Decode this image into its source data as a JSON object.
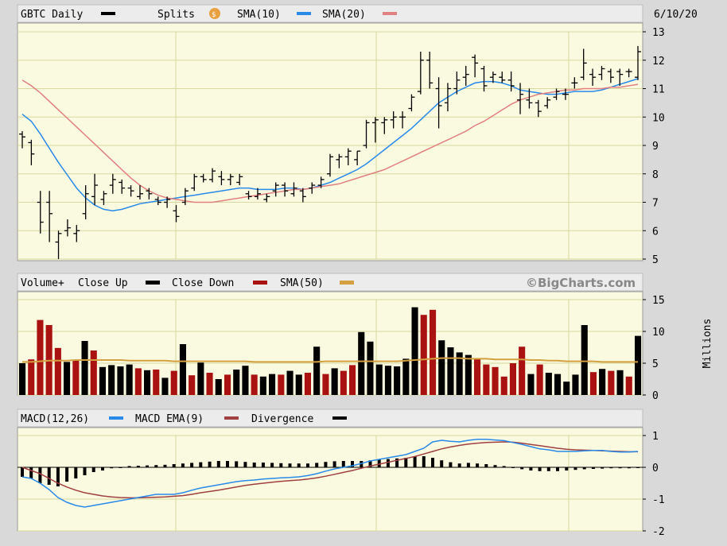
{
  "header": {
    "symbol_label": "GBTC Daily",
    "splits_label": "Splits",
    "splits_icon": "dollar-coin-icon",
    "sma10_label": "SMA(10)",
    "sma20_label": "SMA(20)",
    "date": "6/10/20"
  },
  "volume_header": {
    "title": "Volume+",
    "close_up_label": "Close Up",
    "close_down_label": "Close Down",
    "sma50_label": "SMA(50)",
    "brand": "©BigCharts.com",
    "unit_label": "Millions"
  },
  "macd_header": {
    "macd_label": "MACD(12,26)",
    "ema_label": "MACD EMA(9)",
    "divergence_label": "Divergence"
  },
  "colors": {
    "plot_bg": "#fafae0",
    "grid": "#d8d8a0",
    "frame": "#d9d9d9",
    "header_bg": "#ececec",
    "sma10": "#2a8ae8",
    "sma20": "#e08080",
    "up": "#000000",
    "down": "#aa1111",
    "sma50": "#d4a040",
    "macd": "#2a8ae8",
    "ema": "#a04040",
    "divergence": "#000000"
  },
  "chart_data": [
    {
      "type": "ohlc",
      "title": "GBTC Daily",
      "ylim": [
        5,
        13
      ],
      "yticks": [
        "5",
        "6",
        "7",
        "8",
        "9",
        "10",
        "11",
        "12",
        "13"
      ],
      "grid": true,
      "bars": [
        [
          9.4,
          9.5,
          8.9,
          9.3
        ],
        [
          9.1,
          9.2,
          8.3,
          8.7
        ],
        [
          7.0,
          7.4,
          5.9,
          6.3
        ],
        [
          7.0,
          7.4,
          5.6,
          6.6
        ],
        [
          5.6,
          6.0,
          5.0,
          5.9
        ],
        [
          6.0,
          6.4,
          5.8,
          6.1
        ],
        [
          5.9,
          6.2,
          5.6,
          6.0
        ],
        [
          6.6,
          7.6,
          6.4,
          7.3
        ],
        [
          7.2,
          8.0,
          6.9,
          7.6
        ],
        [
          7.1,
          7.4,
          6.9,
          7.3
        ],
        [
          7.6,
          8.0,
          7.3,
          7.8
        ],
        [
          7.7,
          7.8,
          7.3,
          7.5
        ],
        [
          7.5,
          7.6,
          7.2,
          7.4
        ],
        [
          7.2,
          7.6,
          7.1,
          7.3
        ],
        [
          7.4,
          7.5,
          7.1,
          7.3
        ],
        [
          7.1,
          7.2,
          6.9,
          7.0
        ],
        [
          7.0,
          7.2,
          6.8,
          7.1
        ],
        [
          6.7,
          6.9,
          6.3,
          6.5
        ],
        [
          7.0,
          7.5,
          6.9,
          7.4
        ],
        [
          7.5,
          8.0,
          7.4,
          7.9
        ],
        [
          7.9,
          8.0,
          7.7,
          7.8
        ],
        [
          7.8,
          8.2,
          7.7,
          8.1
        ],
        [
          7.9,
          8.1,
          7.6,
          7.8
        ],
        [
          7.8,
          8.0,
          7.6,
          7.9
        ],
        [
          7.7,
          8.0,
          7.6,
          7.9
        ],
        [
          7.3,
          7.4,
          7.1,
          7.2
        ],
        [
          7.2,
          7.5,
          7.1,
          7.3
        ],
        [
          7.1,
          7.3,
          7.0,
          7.2
        ],
        [
          7.4,
          7.7,
          7.2,
          7.6
        ],
        [
          7.6,
          7.7,
          7.2,
          7.4
        ],
        [
          7.3,
          7.7,
          7.2,
          7.5
        ],
        [
          7.4,
          7.5,
          7.0,
          7.2
        ],
        [
          7.5,
          7.7,
          7.3,
          7.6
        ],
        [
          7.6,
          7.9,
          7.5,
          7.8
        ],
        [
          8.0,
          8.7,
          7.9,
          8.6
        ],
        [
          8.5,
          8.7,
          8.2,
          8.6
        ],
        [
          8.6,
          8.9,
          8.3,
          8.8
        ],
        [
          8.5,
          8.8,
          8.3,
          8.8
        ],
        [
          9.0,
          9.9,
          8.9,
          9.8
        ],
        [
          9.8,
          10.0,
          9.1,
          9.9
        ],
        [
          9.8,
          10.0,
          9.4,
          9.9
        ],
        [
          9.9,
          10.2,
          9.6,
          10.0
        ],
        [
          10.0,
          10.2,
          9.6,
          10.0
        ],
        [
          10.3,
          10.8,
          10.2,
          10.7
        ],
        [
          10.9,
          12.3,
          10.8,
          12.0
        ],
        [
          12.0,
          12.3,
          11.0,
          11.2
        ],
        [
          11.0,
          11.4,
          9.6,
          10.4
        ],
        [
          10.5,
          11.2,
          10.2,
          11.0
        ],
        [
          11.0,
          11.6,
          10.8,
          11.3
        ],
        [
          11.4,
          11.8,
          11.1,
          11.5
        ],
        [
          12.1,
          12.2,
          11.4,
          11.9
        ],
        [
          11.7,
          11.8,
          10.9,
          11.1
        ],
        [
          11.4,
          11.6,
          11.2,
          11.5
        ],
        [
          11.4,
          11.6,
          11.2,
          11.3
        ],
        [
          11.3,
          11.6,
          10.9,
          11.1
        ],
        [
          10.6,
          11.2,
          10.1,
          10.8
        ],
        [
          10.6,
          11.0,
          10.3,
          10.5
        ],
        [
          10.5,
          10.6,
          10.0,
          10.2
        ],
        [
          10.4,
          10.7,
          10.3,
          10.6
        ],
        [
          10.7,
          11.0,
          10.6,
          10.9
        ],
        [
          10.8,
          11.0,
          10.6,
          10.8
        ],
        [
          11.2,
          11.4,
          11.0,
          11.2
        ],
        [
          11.4,
          12.4,
          11.3,
          11.9
        ],
        [
          11.5,
          11.7,
          11.1,
          11.4
        ],
        [
          11.5,
          11.8,
          11.3,
          11.7
        ],
        [
          11.6,
          11.7,
          11.2,
          11.4
        ],
        [
          11.6,
          11.7,
          11.1,
          11.5
        ],
        [
          11.6,
          11.7,
          11.4,
          11.6
        ],
        [
          11.4,
          12.5,
          11.3,
          12.3
        ]
      ],
      "series": [
        {
          "name": "SMA(10)",
          "start_index": 0,
          "values": [
            10.1,
            9.85,
            9.4,
            8.9,
            8.4,
            7.95,
            7.5,
            7.15,
            6.9,
            6.75,
            6.7,
            6.75,
            6.85,
            6.95,
            7.0,
            7.05,
            7.1,
            7.15,
            7.2,
            7.25,
            7.3,
            7.35,
            7.4,
            7.45,
            7.5,
            7.5,
            7.45,
            7.45,
            7.45,
            7.5,
            7.5,
            7.45,
            7.5,
            7.6,
            7.7,
            7.85,
            8.0,
            8.15,
            8.35,
            8.6,
            8.85,
            9.1,
            9.35,
            9.6,
            9.9,
            10.2,
            10.5,
            10.7,
            10.9,
            11.05,
            11.2,
            11.25,
            11.25,
            11.2,
            11.1,
            10.95,
            10.9,
            10.85,
            10.8,
            10.8,
            10.85,
            10.9,
            10.9,
            10.9,
            10.95,
            11.05,
            11.15,
            11.25,
            11.35
          ]
        },
        {
          "name": "SMA(20)",
          "start_index": 0,
          "values": [
            11.3,
            11.1,
            10.85,
            10.55,
            10.25,
            9.95,
            9.65,
            9.35,
            9.05,
            8.75,
            8.45,
            8.15,
            7.85,
            7.6,
            7.4,
            7.25,
            7.15,
            7.1,
            7.05,
            7.0,
            7.0,
            7.0,
            7.05,
            7.1,
            7.15,
            7.2,
            7.25,
            7.3,
            7.35,
            7.4,
            7.45,
            7.45,
            7.5,
            7.55,
            7.6,
            7.65,
            7.75,
            7.85,
            7.95,
            8.05,
            8.15,
            8.3,
            8.45,
            8.6,
            8.75,
            8.9,
            9.05,
            9.2,
            9.35,
            9.5,
            9.7,
            9.85,
            10.05,
            10.25,
            10.45,
            10.6,
            10.7,
            10.8,
            10.85,
            10.9,
            10.95,
            10.95,
            11.0,
            11.0,
            11.0,
            11.05,
            11.05,
            11.1,
            11.15
          ]
        }
      ]
    },
    {
      "type": "bar",
      "title": "Volume+",
      "ylim": [
        0,
        15
      ],
      "yticks": [
        "0",
        "5",
        "10",
        "15"
      ],
      "ylabel": "Millions",
      "values": [
        5.0,
        5.6,
        11.8,
        11.0,
        7.4,
        5.2,
        5.4,
        8.5,
        7.0,
        4.4,
        4.7,
        4.5,
        4.8,
        4.2,
        3.9,
        4.0,
        2.7,
        3.8,
        8.0,
        3.1,
        5.1,
        3.5,
        2.5,
        3.2,
        4.0,
        4.6,
        3.2,
        2.9,
        3.3,
        3.2,
        3.8,
        3.2,
        3.5,
        7.6,
        3.3,
        4.2,
        3.8,
        4.7,
        9.9,
        8.4,
        4.8,
        4.6,
        4.5,
        5.7,
        13.8,
        12.6,
        13.4,
        8.6,
        7.5,
        6.7,
        6.3,
        5.7,
        4.8,
        4.4,
        2.9,
        5.0,
        7.6,
        3.3,
        4.8,
        3.5,
        3.3,
        2.1,
        3.2,
        11.0,
        3.6,
        4.1,
        3.8,
        3.9,
        2.9,
        9.3
      ],
      "up": [
        true,
        false,
        false,
        false,
        false,
        true,
        false,
        true,
        false,
        true,
        true,
        true,
        true,
        false,
        true,
        false,
        true,
        false,
        true,
        false,
        true,
        false,
        true,
        false,
        true,
        true,
        false,
        true,
        true,
        false,
        true,
        true,
        false,
        true,
        false,
        true,
        false,
        false,
        true,
        true,
        true,
        true,
        true,
        true,
        true,
        false,
        false,
        true,
        true,
        true,
        true,
        false,
        false,
        false,
        false,
        false,
        false,
        true,
        false,
        true,
        true,
        true,
        true,
        true,
        false,
        true,
        false,
        true,
        false,
        true
      ],
      "sma50": [
        5.2,
        5.2,
        5.3,
        5.4,
        5.4,
        5.4,
        5.5,
        5.5,
        5.5,
        5.5,
        5.5,
        5.5,
        5.4,
        5.4,
        5.4,
        5.4,
        5.4,
        5.3,
        5.3,
        5.3,
        5.3,
        5.3,
        5.3,
        5.3,
        5.3,
        5.3,
        5.2,
        5.2,
        5.2,
        5.2,
        5.2,
        5.2,
        5.2,
        5.2,
        5.3,
        5.3,
        5.3,
        5.3,
        5.3,
        5.3,
        5.3,
        5.3,
        5.3,
        5.4,
        5.5,
        5.6,
        5.7,
        5.8,
        5.8,
        5.8,
        5.7,
        5.7,
        5.7,
        5.6,
        5.6,
        5.6,
        5.6,
        5.5,
        5.5,
        5.4,
        5.4,
        5.3,
        5.3,
        5.3,
        5.3,
        5.2,
        5.2,
        5.2,
        5.2,
        5.2
      ]
    },
    {
      "type": "line",
      "title": "MACD(12,26)",
      "ylim": [
        -2,
        1
      ],
      "yticks": [
        "-2",
        "-1",
        "0",
        "1"
      ],
      "series": [
        {
          "name": "MACD(12,26)",
          "values": [
            -0.3,
            -0.35,
            -0.5,
            -0.7,
            -0.95,
            -1.1,
            -1.2,
            -1.25,
            -1.2,
            -1.15,
            -1.1,
            -1.05,
            -1.0,
            -0.95,
            -0.9,
            -0.85,
            -0.85,
            -0.85,
            -0.8,
            -0.72,
            -0.65,
            -0.6,
            -0.55,
            -0.5,
            -0.45,
            -0.42,
            -0.4,
            -0.37,
            -0.35,
            -0.33,
            -0.32,
            -0.3,
            -0.26,
            -0.2,
            -0.12,
            -0.05,
            0.0,
            0.05,
            0.12,
            0.2,
            0.25,
            0.3,
            0.35,
            0.4,
            0.5,
            0.6,
            0.8,
            0.85,
            0.82,
            0.8,
            0.85,
            0.88,
            0.88,
            0.86,
            0.84,
            0.78,
            0.72,
            0.65,
            0.58,
            0.55,
            0.5,
            0.5,
            0.5,
            0.52,
            0.53,
            0.53,
            0.5,
            0.48,
            0.48,
            0.5
          ]
        },
        {
          "name": "MACD EMA(9)",
          "values": [
            0.0,
            -0.1,
            -0.2,
            -0.35,
            -0.5,
            -0.62,
            -0.72,
            -0.8,
            -0.85,
            -0.9,
            -0.93,
            -0.95,
            -0.96,
            -0.96,
            -0.95,
            -0.94,
            -0.93,
            -0.91,
            -0.89,
            -0.85,
            -0.8,
            -0.76,
            -0.72,
            -0.67,
            -0.62,
            -0.57,
            -0.53,
            -0.5,
            -0.47,
            -0.44,
            -0.42,
            -0.4,
            -0.37,
            -0.33,
            -0.28,
            -0.22,
            -0.16,
            -0.1,
            -0.03,
            0.04,
            0.1,
            0.16,
            0.22,
            0.28,
            0.34,
            0.42,
            0.5,
            0.58,
            0.64,
            0.69,
            0.73,
            0.76,
            0.78,
            0.79,
            0.8,
            0.79,
            0.76,
            0.72,
            0.68,
            0.64,
            0.6,
            0.57,
            0.55,
            0.54,
            0.53,
            0.52,
            0.51,
            0.5,
            0.49,
            0.49
          ]
        },
        {
          "name": "Divergence",
          "type": "bar",
          "values": [
            -0.3,
            -0.35,
            -0.5,
            -0.55,
            -0.6,
            -0.45,
            -0.35,
            -0.25,
            -0.15,
            -0.1,
            -0.03,
            0.0,
            0.04,
            0.05,
            0.06,
            0.07,
            0.08,
            0.1,
            0.12,
            0.14,
            0.16,
            0.18,
            0.2,
            0.2,
            0.19,
            0.17,
            0.15,
            0.15,
            0.14,
            0.13,
            0.12,
            0.12,
            0.12,
            0.14,
            0.17,
            0.19,
            0.2,
            0.2,
            0.2,
            0.22,
            0.24,
            0.26,
            0.28,
            0.3,
            0.34,
            0.35,
            0.3,
            0.22,
            0.16,
            0.12,
            0.14,
            0.12,
            0.1,
            0.07,
            0.04,
            -0.02,
            -0.06,
            -0.1,
            -0.12,
            -0.12,
            -0.12,
            -0.1,
            -0.08,
            -0.06,
            -0.05,
            -0.04,
            -0.03,
            -0.03,
            -0.03,
            -0.02
          ]
        }
      ]
    }
  ]
}
